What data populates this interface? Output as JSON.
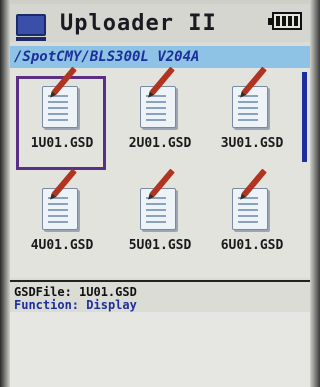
{
  "header": {
    "title": "Uploader II",
    "app_icon": "monitor-icon",
    "battery_icon": "battery-full-icon"
  },
  "path": "/SpotCMY/BLS300L V204A",
  "files": [
    {
      "name": "1U01.GSD",
      "selected": true
    },
    {
      "name": "2U01.GSD",
      "selected": false
    },
    {
      "name": "3U01.GSD",
      "selected": false
    },
    {
      "name": "4U01.GSD",
      "selected": false
    },
    {
      "name": "5U01.GSD",
      "selected": false
    },
    {
      "name": "6U01.GSD",
      "selected": false
    }
  ],
  "info": {
    "gsd_label": "GSDFile:",
    "gsd_value": "1U01.GSD",
    "function_label": "Function:",
    "function_value": "Display"
  },
  "colors": {
    "accent": "#1d2f9a",
    "path_bar": "#8ec3e6",
    "selection": "#5a2f86"
  }
}
